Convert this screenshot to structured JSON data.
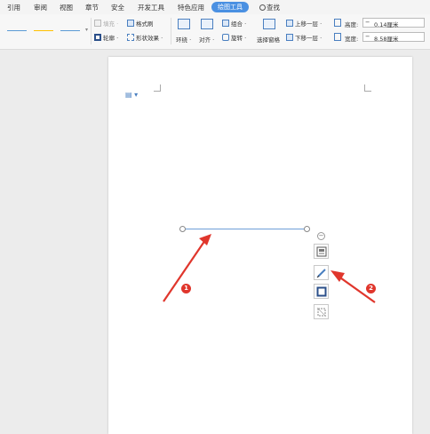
{
  "menu": {
    "items": [
      "引用",
      "审阅",
      "视图",
      "章节",
      "安全",
      "开发工具",
      "特色应用",
      "绘图工具"
    ],
    "search_label": "查找"
  },
  "ribbon": {
    "line_colors": [
      "#5b9bd5",
      "#ffc000",
      "#5b9bd5"
    ],
    "fill_label": "填充 ·",
    "format_brush_label": "格式刷",
    "outline_label": "轮廓 ·",
    "shape_effects_label": "形状效果 ·",
    "wrap_label": "环绕 ·",
    "align_label": "对齐 ·",
    "group_label": "组合 ·",
    "rotate_label": "旋转 ·",
    "selection_pane_label": "选择窗格",
    "bring_forward_label": "上移一层 ·",
    "send_backward_label": "下移一层 ·",
    "height_label": "高度:",
    "height_value": "0.14厘米",
    "width_label": "宽度:",
    "width_value": "8.58厘米"
  },
  "document": {
    "annotations": [
      "1",
      "2"
    ],
    "accent_color": "#4a90e2",
    "arrow_color": "#e0362c"
  }
}
